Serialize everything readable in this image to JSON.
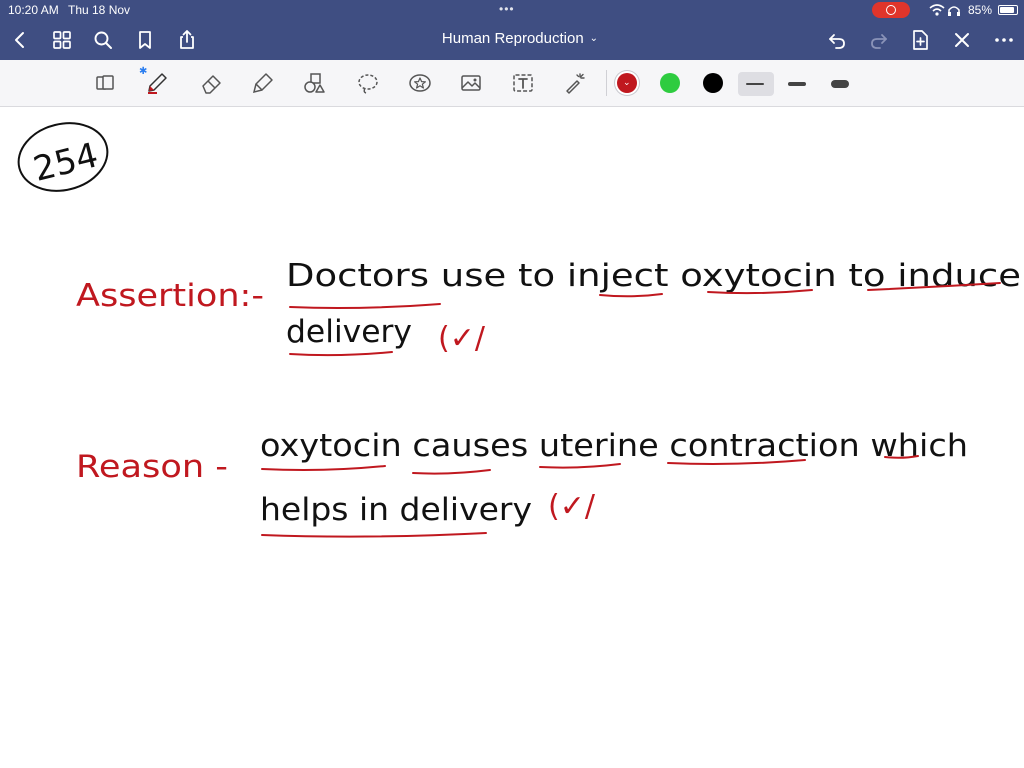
{
  "status_bar": {
    "time": "10:20 AM",
    "date": "Thu 18 Nov",
    "battery_percent": "85%",
    "battery_level": 0.85
  },
  "nav_bar": {
    "title": "Human Reproduction",
    "icons": [
      "back-icon",
      "grid-icon",
      "search-icon",
      "bookmark-icon",
      "share-icon",
      "undo-icon",
      "redo-icon",
      "add-page-icon",
      "close-icon",
      "more-icon"
    ]
  },
  "toolbar": {
    "tools": [
      "lasso-page-icon",
      "pen-icon",
      "eraser-icon",
      "highlighter-icon",
      "shapes-icon",
      "lasso-icon",
      "sticker-icon",
      "image-icon",
      "text-icon",
      "laser-pointer-icon"
    ],
    "colors": [
      "#c0181f",
      "#2ecc40",
      "#000000"
    ],
    "selected_color": "#c0181f",
    "thickness_options": [
      "thin",
      "medium",
      "thick"
    ],
    "selected_thickness": "thin"
  },
  "note": {
    "question_number": "254",
    "assertion_label": "Assertion:-",
    "assertion_line1": "Doctors use to inject oxytocin to induce",
    "assertion_line2": "delivery",
    "assertion_mark": "(✓/",
    "reason_label": "Reason -",
    "reason_line1": "oxytocin causes uterine contraction which",
    "reason_line2": "helps in delivery",
    "reason_mark": "(✓/",
    "ink_colors": {
      "black": "#111111",
      "red": "#c0181f"
    }
  }
}
